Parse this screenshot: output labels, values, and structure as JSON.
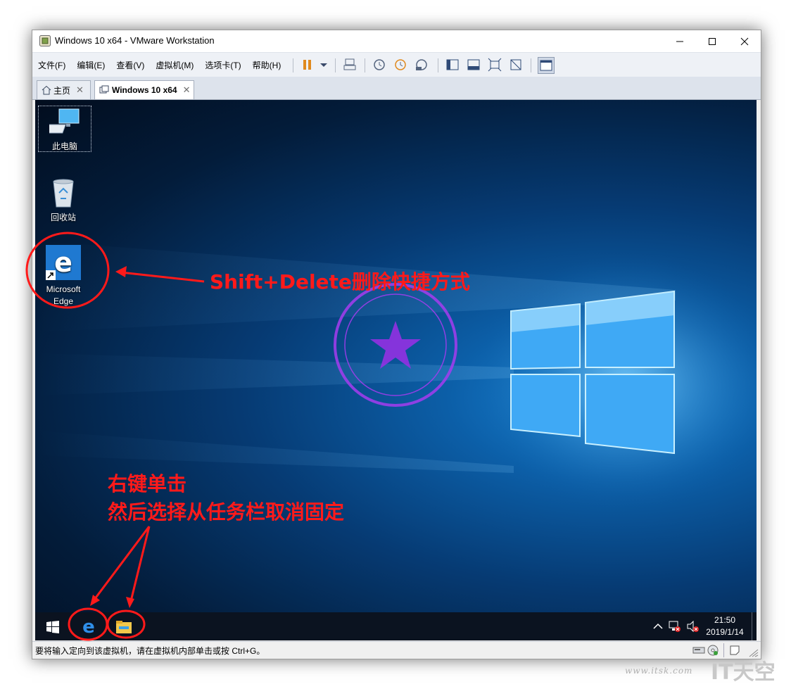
{
  "window": {
    "title": "Windows 10 x64 - VMware Workstation",
    "menu": [
      "文件(F)",
      "编辑(E)",
      "查看(V)",
      "虚拟机(M)",
      "选项卡(T)",
      "帮助(H)"
    ],
    "tabs": [
      {
        "label": "主页",
        "icon": "home-icon"
      },
      {
        "label": "Windows 10 x64",
        "icon": "vm-icon"
      }
    ],
    "status_text": "要将输入定向到该虚拟机，请在虚拟机内部单击或按 Ctrl+G。"
  },
  "desktop": {
    "icons": [
      {
        "label": "此电脑",
        "icon": "this-pc-icon"
      },
      {
        "label": "回收站",
        "icon": "recycle-bin-icon"
      },
      {
        "label": "Microsoft Edge",
        "icon": "edge-icon"
      }
    ]
  },
  "taskbar": {
    "time": "21:50",
    "date": "2019/1/14"
  },
  "annotations": {
    "edge_note": "Shift+Delete删除快捷方式",
    "taskbar_note_1": "右键单击",
    "taskbar_note_2": "然后选择从任务栏取消固定"
  },
  "watermark": {
    "site": "www.itsk.com",
    "brand": "IT天空"
  },
  "colors": {
    "annotation": "#ff1a1a",
    "desktop_blue": "#0c5fa8",
    "taskbar": "#0b1320"
  }
}
